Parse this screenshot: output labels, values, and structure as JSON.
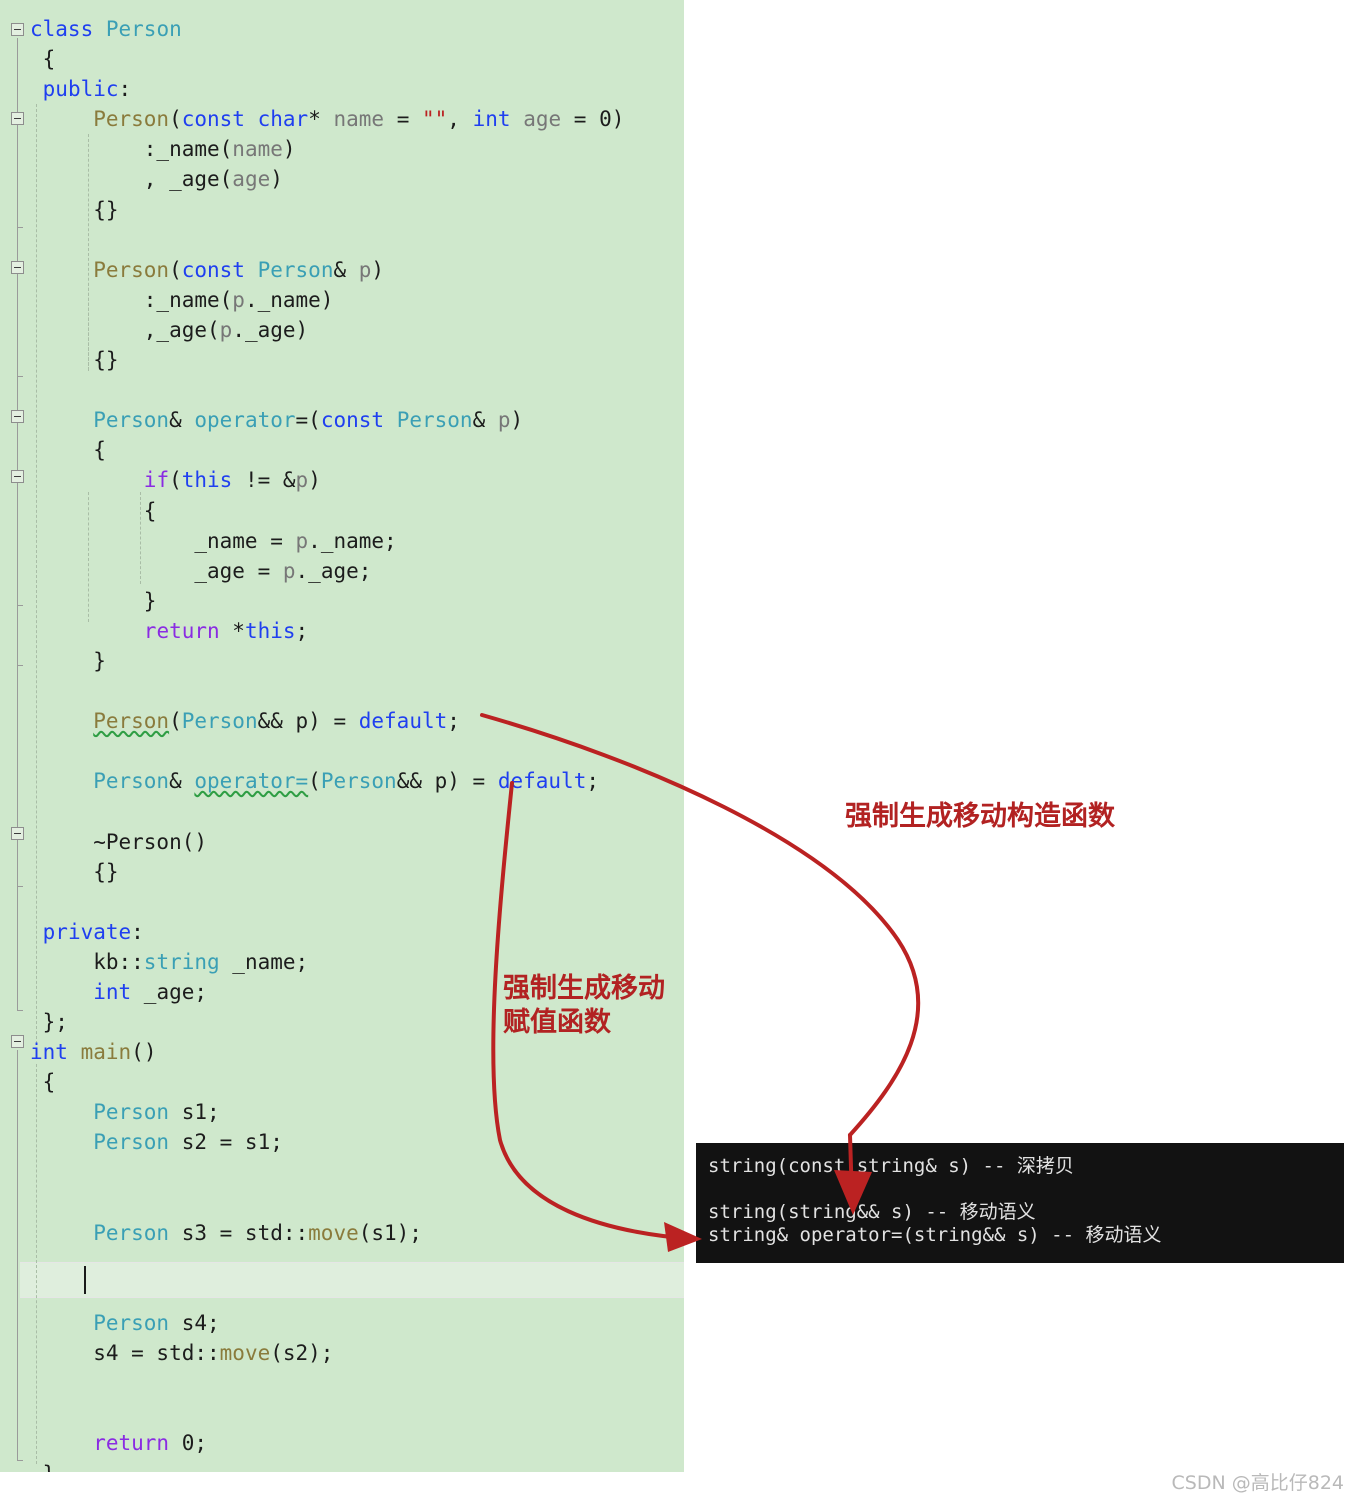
{
  "editor": {
    "background_color": "#cfe8cc",
    "current_line_color": "#dfeedd",
    "code_lines": [
      "class Person",
      "{",
      "public:",
      "    Person(const char* name = \"\", int age = 0)",
      "        :_name(name)",
      "        , _age(age)",
      "    {}",
      "",
      "    Person(const Person& p)",
      "        :_name(p._name)",
      "        ,_age(p._age)",
      "    {}",
      "",
      "    Person& operator=(const Person& p)",
      "    {",
      "        if(this != &p)",
      "        {",
      "            _name = p._name;",
      "            _age = p._age;",
      "        }",
      "        return *this;",
      "    }",
      "",
      "    Person(Person&& p) = default;",
      "",
      "    Person& operator=(Person&& p) = default;",
      "",
      "    ~Person()",
      "    {}",
      "",
      "private:",
      "    kb::string _name;",
      "    int _age;",
      "};",
      "int main()",
      "{",
      "    Person s1;",
      "    Person s2 = s1;",
      "",
      "",
      "    Person s3 = std::move(s1);",
      "",
      "",
      "    Person s4;",
      "    s4 = std::move(s2);",
      "",
      "",
      "    return 0;",
      "}"
    ]
  },
  "console": {
    "background_color": "#121212",
    "text_color": "#e2e2e2",
    "lines": [
      "string(const string& s) -- 深拷贝",
      "",
      "string(string&& s) -- 移动语义",
      "string& operator=(string&& s) -- 移动语义"
    ]
  },
  "annotations": {
    "color": "#b22222",
    "move_constructor": "强制生成移动构造函数",
    "move_assignment": "强制生成移动\n赋值函数"
  },
  "watermark": {
    "text": "CSDN @高比仔824"
  }
}
